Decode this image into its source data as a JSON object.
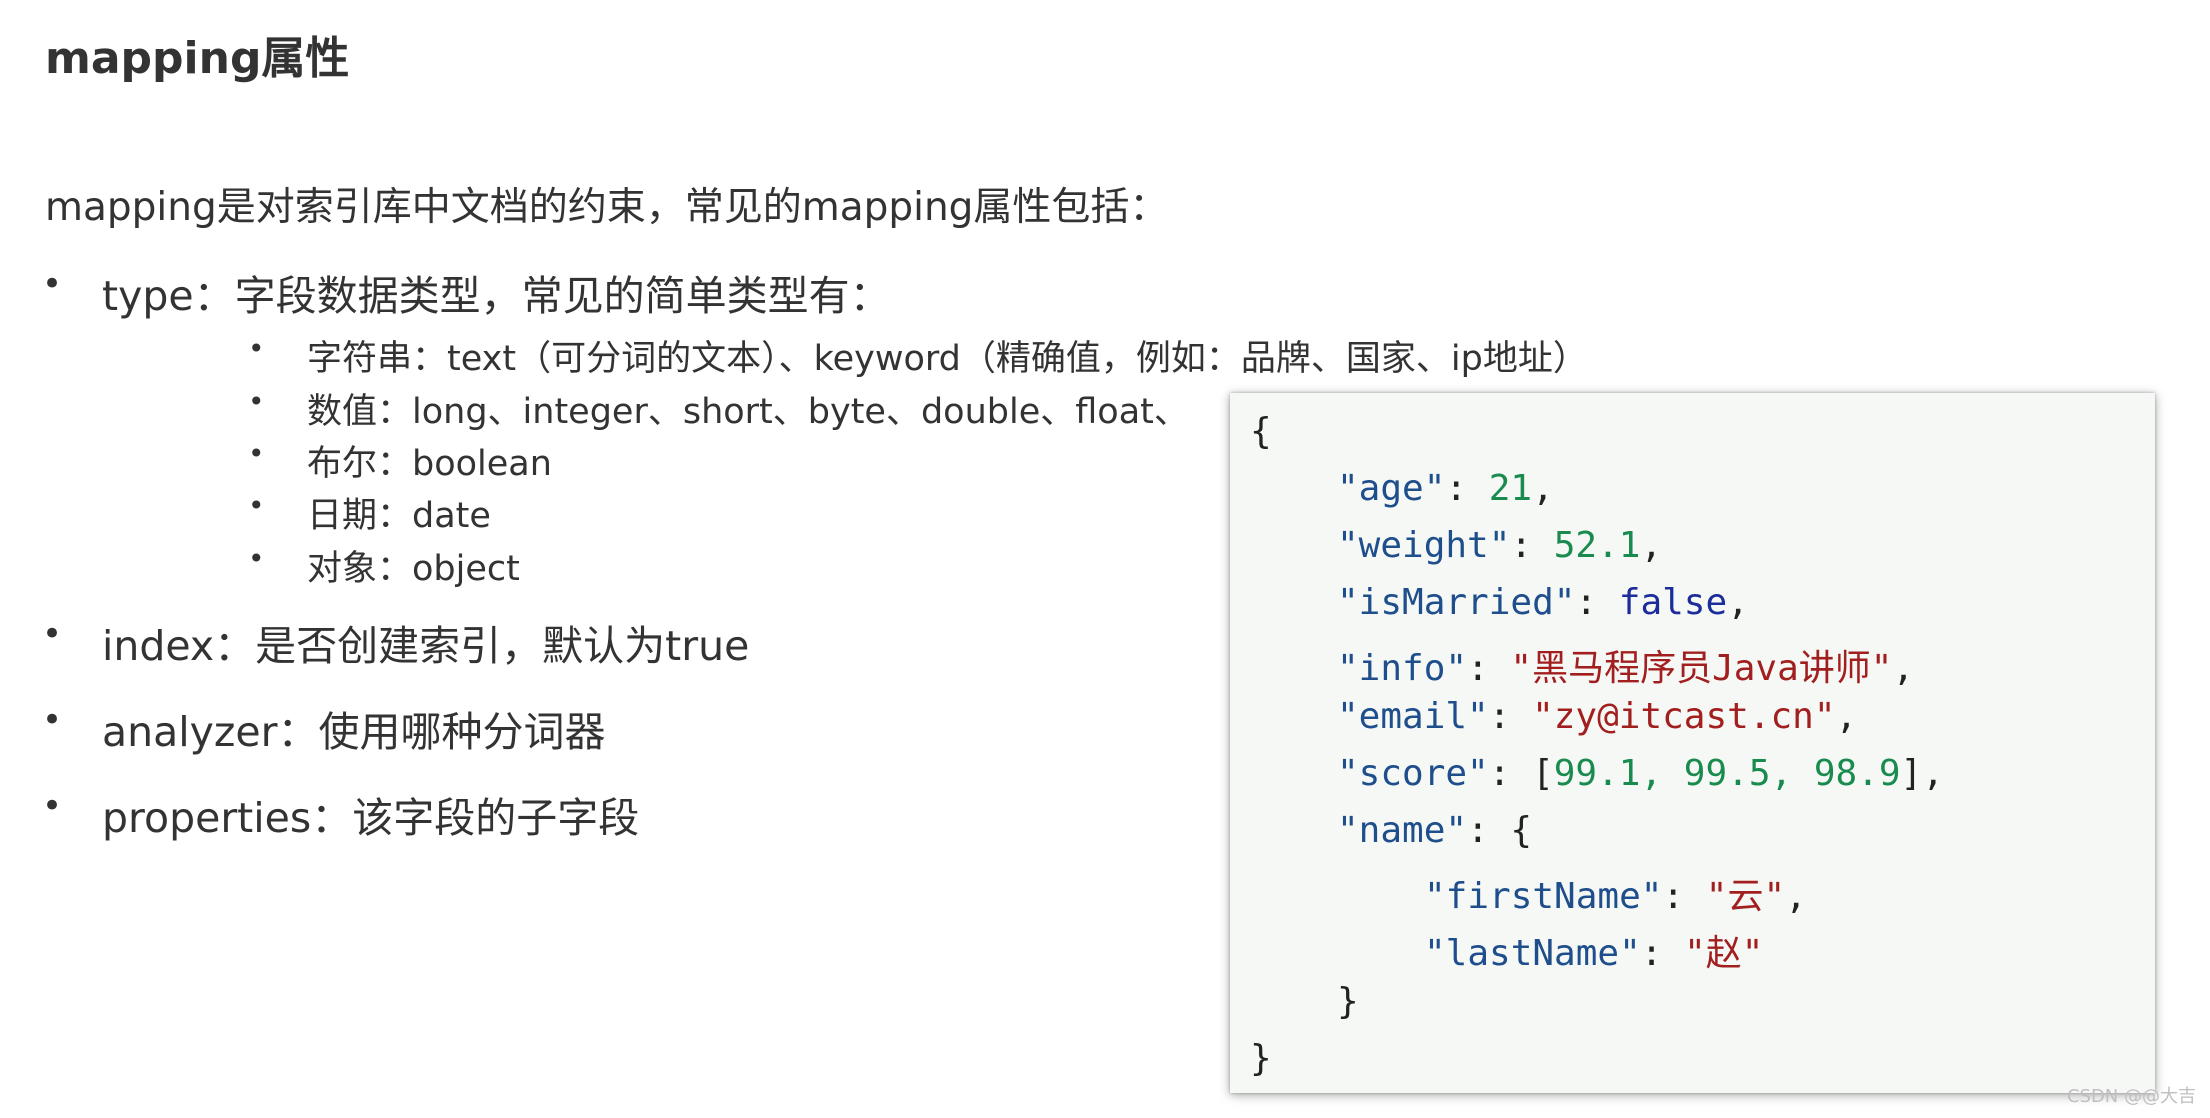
{
  "title": "mapping属性",
  "intro": "mapping是对索引库中文档的约束，常见的mapping属性包括：",
  "bullets": {
    "type": "type：字段数据类型，常见的简单类型有：",
    "sub": {
      "string": "字符串：text（可分词的文本）、keyword（精确值，例如：品牌、国家、ip地址）",
      "number": "数值：long、integer、short、byte、double、float、",
      "boolean": "布尔：boolean",
      "date": "日期：date",
      "object": "对象：object"
    },
    "index": "index：是否创建索引，默认为true",
    "analyzer": "analyzer：使用哪种分词器",
    "properties": "properties：该字段的子字段"
  },
  "bullet_glyph": "•",
  "code": {
    "open_brace": "{",
    "age_key": "\"age\"",
    "age_val": "21",
    "weight_key": "\"weight\"",
    "weight_val": "52.1",
    "married_key": "\"isMarried\"",
    "married_val": "false",
    "info_key": "\"info\"",
    "info_val": "\"黑马程序员Java讲师\"",
    "email_key": "\"email\"",
    "email_val": "\"zy@itcast.cn\"",
    "score_key": "\"score\"",
    "score_val": "99.1, 99.5, 98.9",
    "name_key": "\"name\"",
    "first_key": "\"firstName\"",
    "first_val": "\"云\"",
    "last_key": "\"lastName\"",
    "last_val": "\"赵\"",
    "inner_close": "}",
    "close_brace": "}"
  },
  "watermark": "CSDN @@大吉",
  "colors": {
    "key": "#1f4e8c",
    "number": "#1a8b4e",
    "string": "#a21f1f",
    "boolean": "#1d2c9b",
    "code_bg": "#f6f8f5"
  }
}
